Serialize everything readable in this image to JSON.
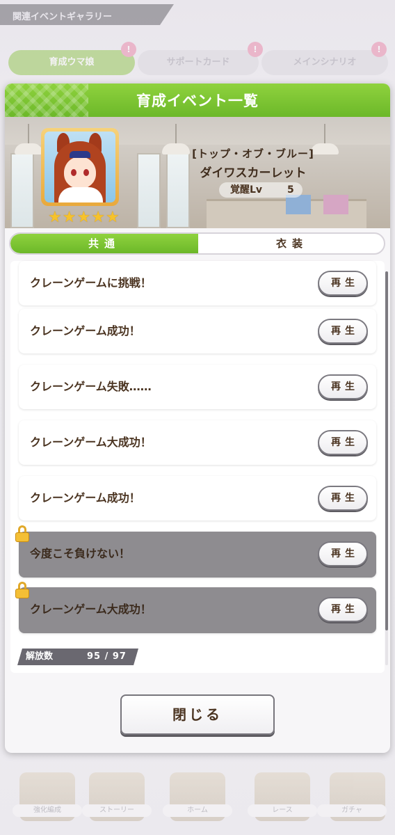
{
  "background": {
    "header_title": "関連イベントギャラリー",
    "tabs": [
      {
        "label": "育成ウマ娘",
        "badge": "!"
      },
      {
        "label": "サポートカード",
        "badge": "!"
      },
      {
        "label": "メインシナリオ",
        "badge": "!"
      }
    ],
    "bottom_menu": [
      "強化編成",
      "ストーリー",
      "ホーム",
      "レース",
      "ガチャ"
    ]
  },
  "dialog": {
    "title": "育成イベント一覧",
    "card": {
      "title": "[トップ・オブ・ブルー]",
      "name": "ダイワスカーレット",
      "awaken_label": "覚醒Lv",
      "awaken_value": "5",
      "stars": 5
    },
    "tabs": [
      {
        "label": "共通",
        "active": true
      },
      {
        "label": "衣装",
        "active": false
      }
    ],
    "events": [
      {
        "title": "クレーンゲームに挑戦！",
        "locked": false,
        "button": "再生"
      },
      {
        "title": "クレーンゲーム成功！",
        "locked": false,
        "button": "再生"
      },
      {
        "title": "クレーンゲーム失敗……",
        "locked": false,
        "button": "再生"
      },
      {
        "title": "クレーンゲーム大成功！",
        "locked": false,
        "button": "再生"
      },
      {
        "title": "クレーンゲーム成功！",
        "locked": false,
        "button": "再生"
      },
      {
        "title": "今度こそ負けない！",
        "locked": true,
        "button": "再生"
      },
      {
        "title": "クレーンゲーム大成功！",
        "locked": true,
        "button": "再生"
      }
    ],
    "release": {
      "label": "解放数",
      "value": "95 /  97"
    },
    "close_label": "閉じる"
  },
  "colors": {
    "accent_green": "#7cc432",
    "locked_row": "#8e8c90",
    "text_brown": "#4a3320"
  }
}
